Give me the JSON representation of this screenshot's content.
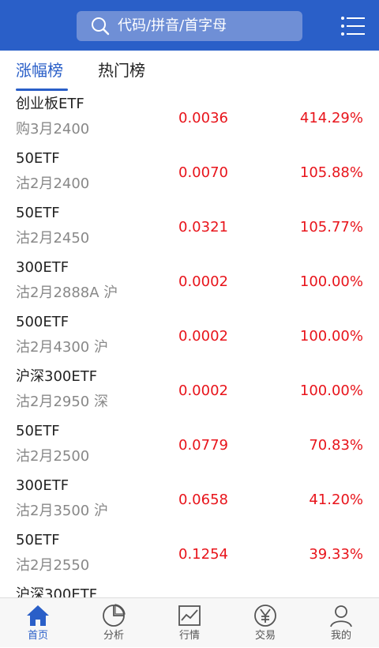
{
  "header": {
    "search_placeholder": "代码/拼音/首字母"
  },
  "tabs": [
    {
      "label": "涨幅榜",
      "active": true
    },
    {
      "label": "热门榜",
      "active": false
    }
  ],
  "rows": [
    {
      "name": "创业板ETF",
      "sub": "购3月2400",
      "price": "0.0036",
      "change": "414.29%"
    },
    {
      "name": "50ETF",
      "sub": "沽2月2400",
      "price": "0.0070",
      "change": "105.88%"
    },
    {
      "name": "50ETF",
      "sub": "沽2月2450",
      "price": "0.0321",
      "change": "105.77%"
    },
    {
      "name": "300ETF",
      "sub": "沽2月2888A 沪",
      "price": "0.0002",
      "change": "100.00%"
    },
    {
      "name": "500ETF",
      "sub": "沽2月4300 沪",
      "price": "0.0002",
      "change": "100.00%"
    },
    {
      "name": "沪深300ETF",
      "sub": "沽2月2950 深",
      "price": "0.0002",
      "change": "100.00%"
    },
    {
      "name": "50ETF",
      "sub": "沽2月2500",
      "price": "0.0779",
      "change": "70.83%"
    },
    {
      "name": "300ETF",
      "sub": "沽2月3500 沪",
      "price": "0.0658",
      "change": "41.20%"
    },
    {
      "name": "50ETF",
      "sub": "沽2月2550",
      "price": "0.1254",
      "change": "39.33%"
    },
    {
      "name": "沪深300ETF",
      "sub": "",
      "price": "",
      "change": ""
    }
  ],
  "nav": [
    {
      "label": "首页",
      "icon": "home-icon",
      "active": true
    },
    {
      "label": "分析",
      "icon": "pie-chart-icon",
      "active": false
    },
    {
      "label": "行情",
      "icon": "line-chart-icon",
      "active": false
    },
    {
      "label": "交易",
      "icon": "yen-icon",
      "active": false
    },
    {
      "label": "我的",
      "icon": "user-icon",
      "active": false
    }
  ],
  "colors": {
    "brand": "#2a5fc8",
    "up": "#e8141b"
  }
}
